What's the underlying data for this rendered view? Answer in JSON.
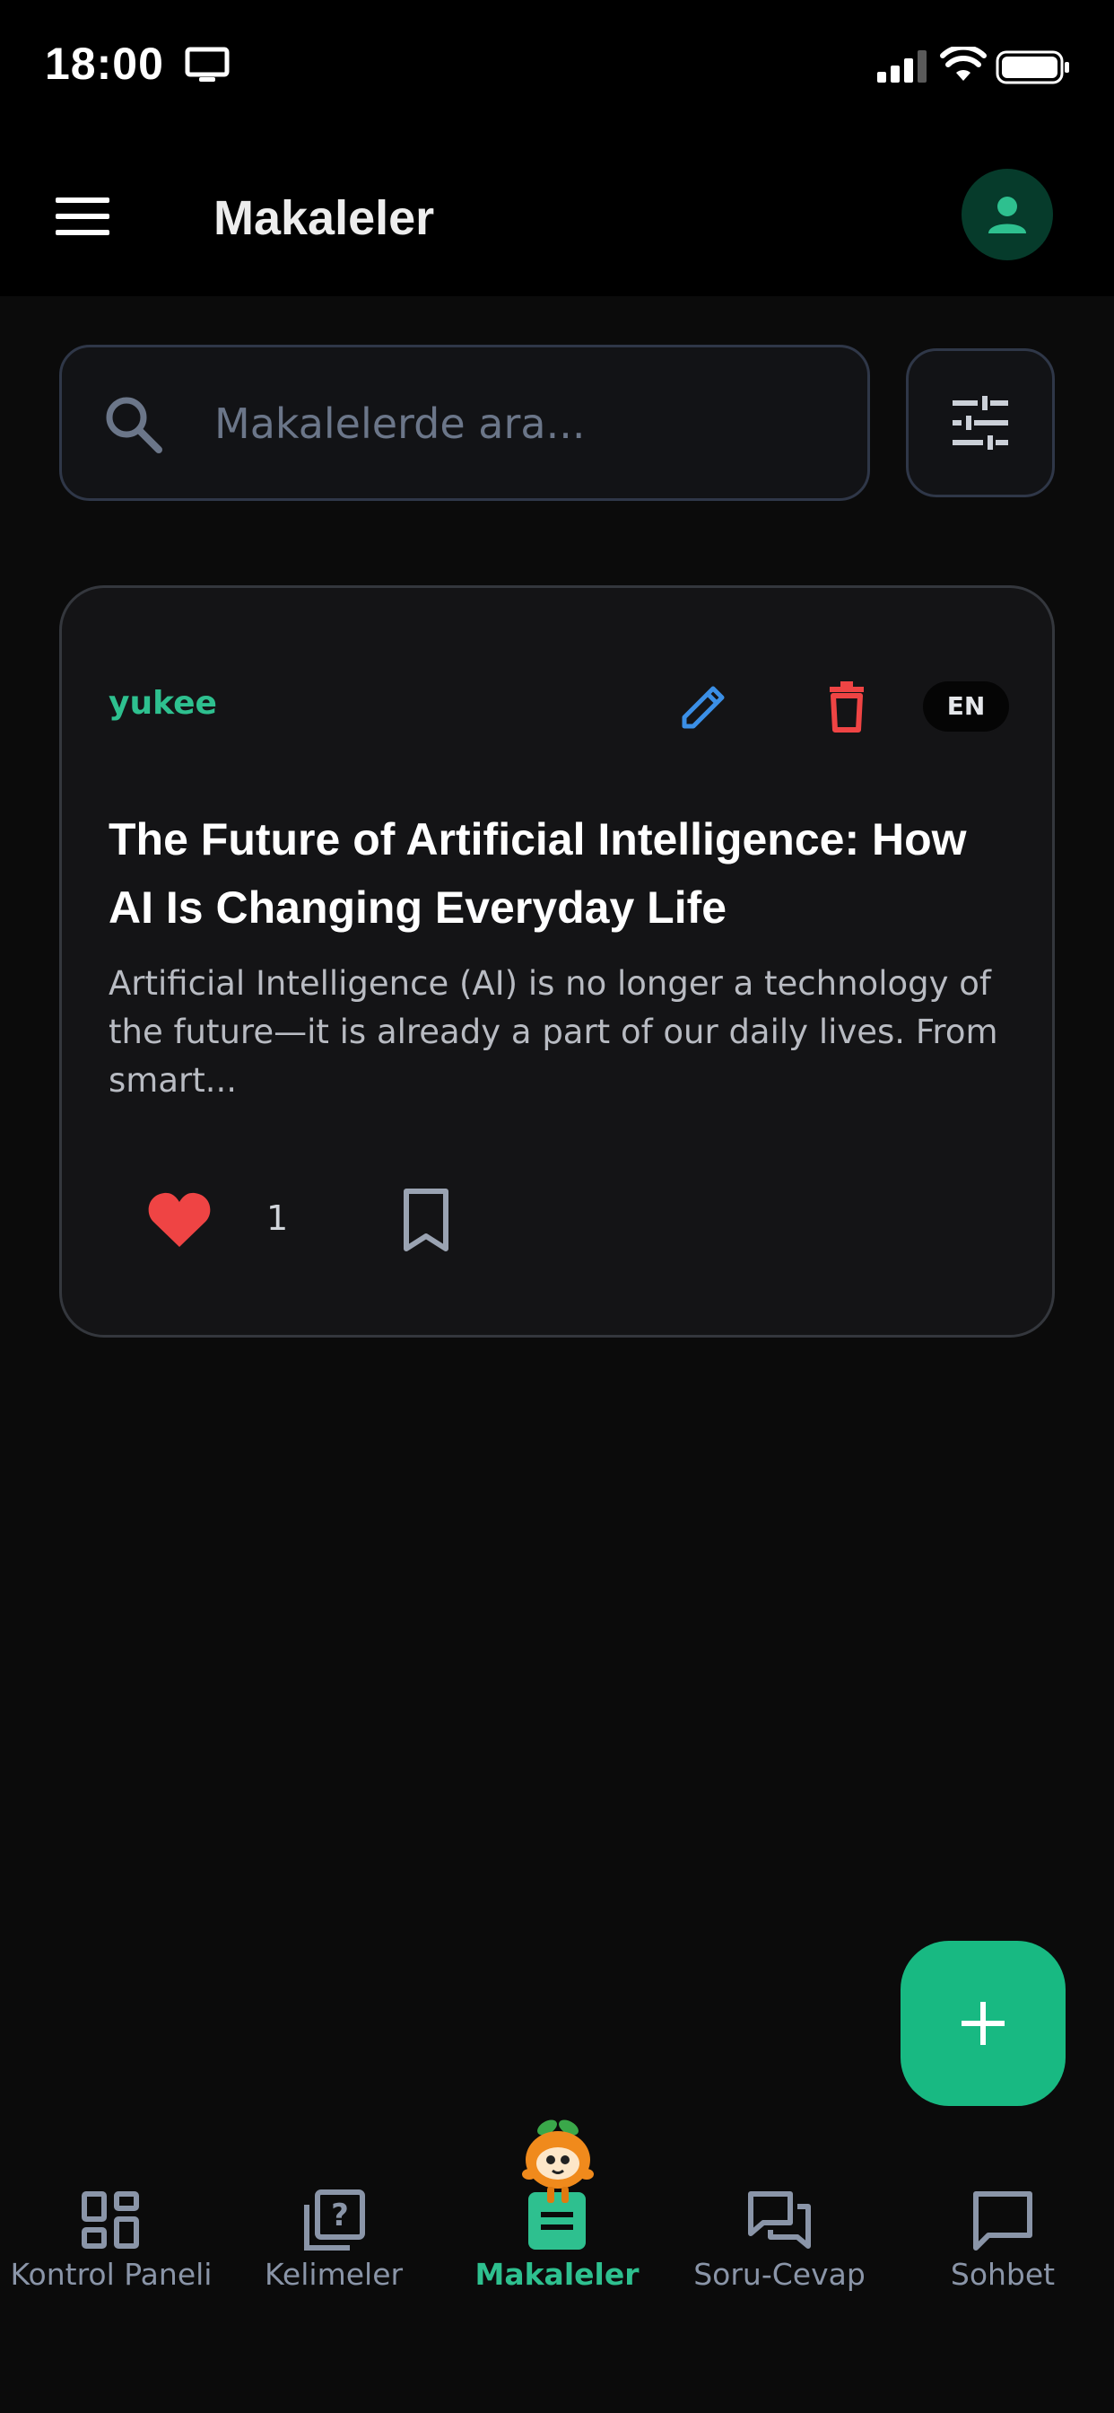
{
  "status_bar": {
    "time": "18:00",
    "screen_icon": "monitor-icon",
    "signal_icon": "cellular-signal-icon",
    "wifi_icon": "wifi-icon",
    "battery_icon": "battery-icon"
  },
  "app_bar": {
    "menu_icon": "hamburger-menu-icon",
    "title": "Makaleler",
    "profile_icon": "person-icon"
  },
  "search": {
    "placeholder": "Makalelerde ara...",
    "value": "",
    "icon": "search-icon",
    "filter_icon": "tune-filter-icon"
  },
  "articles": [
    {
      "author": "yukee",
      "language": "EN",
      "title": "The Future of Artificial Intelligence: How AI Is Changing Everyday Life",
      "excerpt": "Artificial Intelligence (AI) is no longer a technology of the future—it is already a part of our daily lives. From smart...",
      "likes": "1",
      "liked": true,
      "bookmarked": false
    }
  ],
  "fab": {
    "icon": "plus-icon"
  },
  "bottom_nav": {
    "active": "Makaleler",
    "items": [
      {
        "label": "Kontrol Paneli",
        "icon": "dashboard-icon"
      },
      {
        "label": "Kelimeler",
        "icon": "question-library-icon"
      },
      {
        "label": "Makaleler",
        "icon": "article-icon"
      },
      {
        "label": "Soru-Cevap",
        "icon": "forum-icon"
      },
      {
        "label": "Sohbet",
        "icon": "chat-bubble-icon"
      }
    ]
  },
  "colors": {
    "accent": "#2ec08f",
    "fab": "#18b982",
    "edit": "#3b8fe6",
    "delete": "#ef4444",
    "like": "#ef4444",
    "background": "#0b0b0b"
  }
}
